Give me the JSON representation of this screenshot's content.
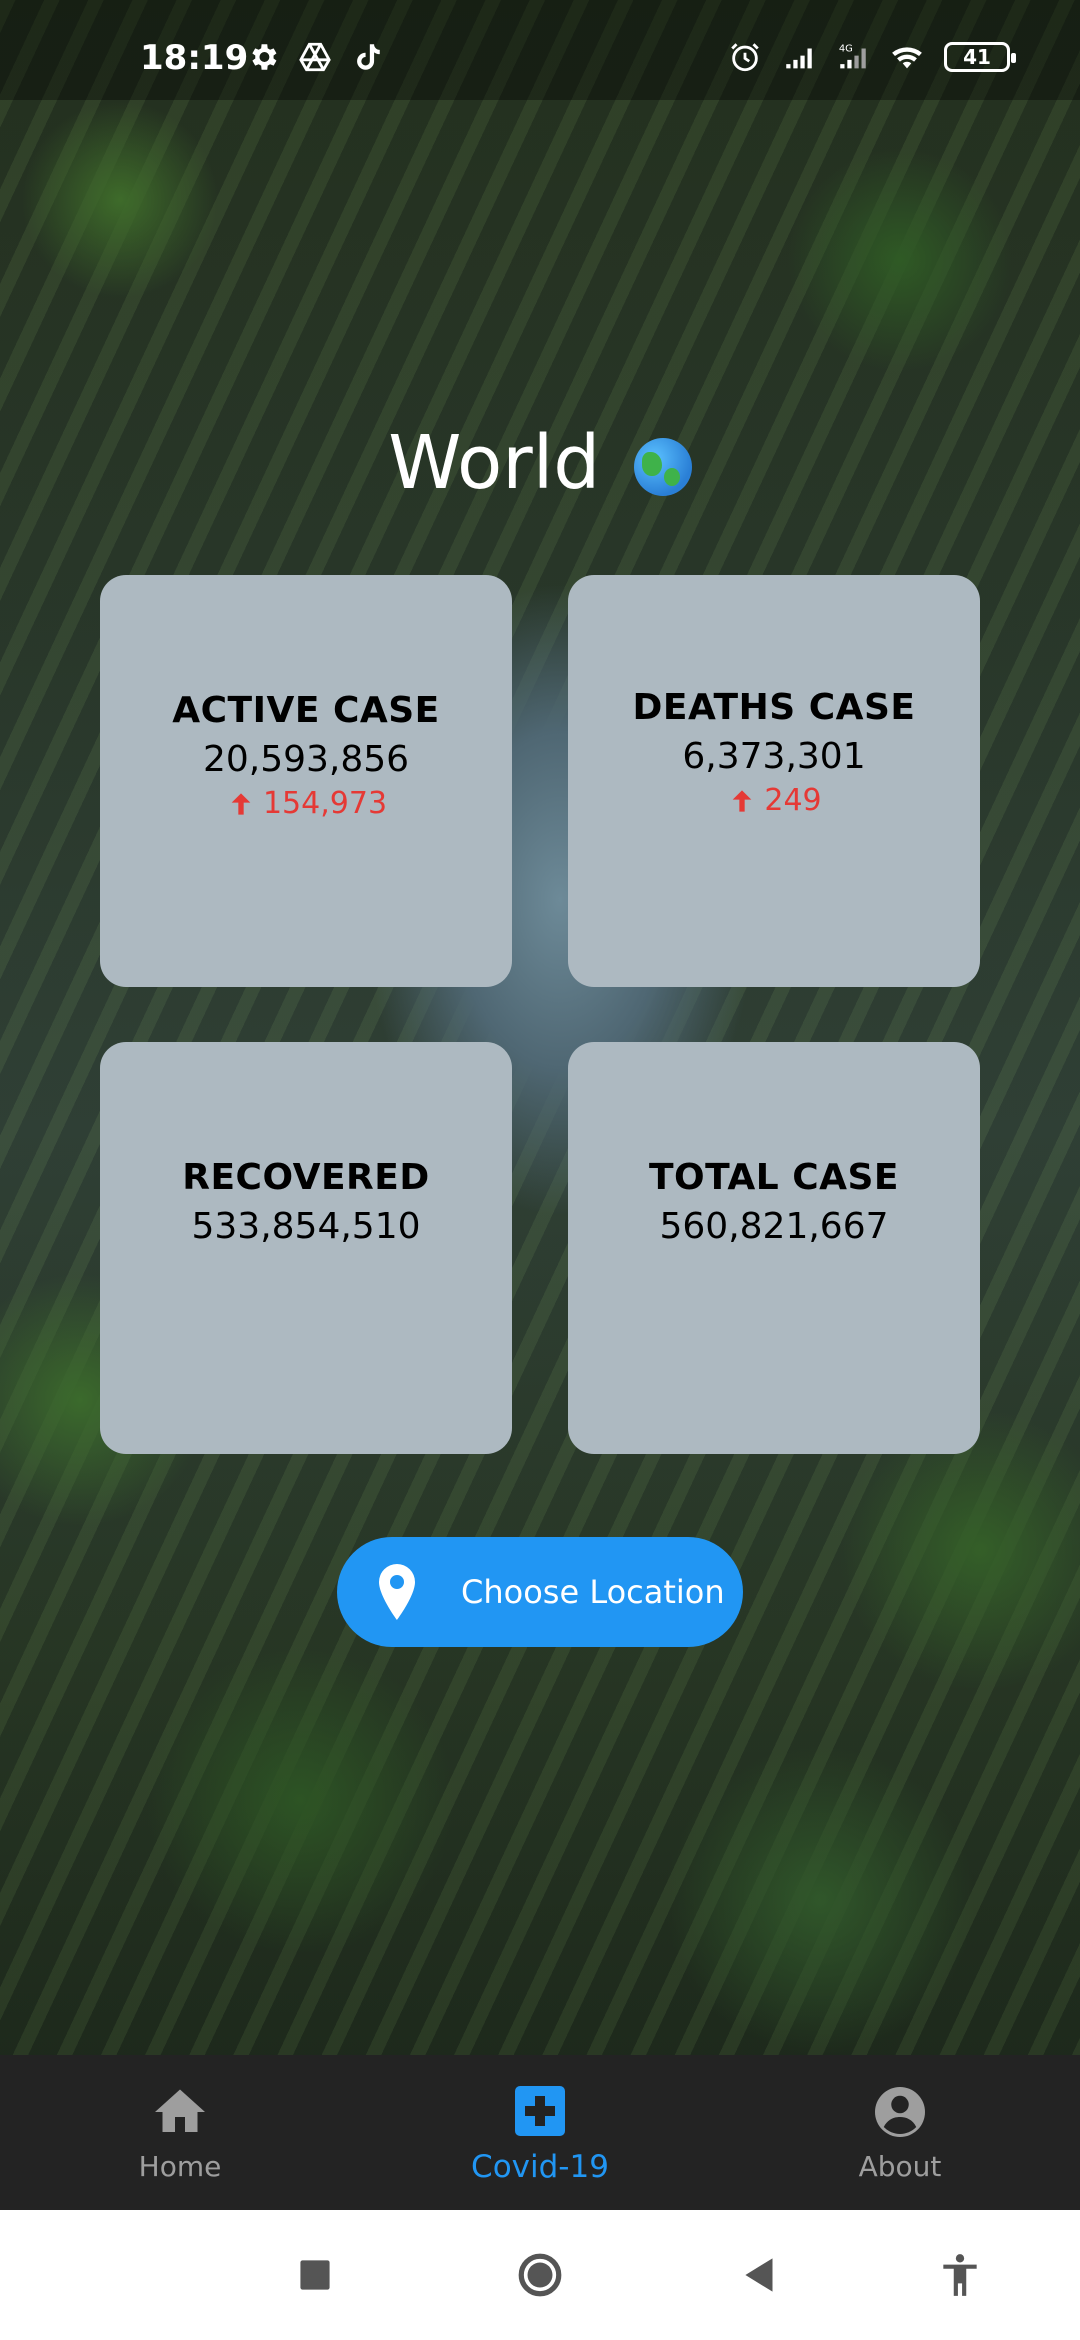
{
  "status": {
    "time": "18:19",
    "battery": "41",
    "left_icons": [
      "gear-icon",
      "drive-icon",
      "tiktok-icon"
    ],
    "right_icons": [
      "alarm-icon",
      "signal-icon",
      "4g-signal-icon",
      "wifi-icon",
      "battery-icon"
    ]
  },
  "title": "World",
  "cards": {
    "active": {
      "label": "ACTIVE CASE",
      "value": "20,593,856",
      "delta": "154,973"
    },
    "deaths": {
      "label": "DEATHS CASE",
      "value": "6,373,301",
      "delta": "249"
    },
    "recovered": {
      "label": "RECOVERED",
      "value": "533,854,510"
    },
    "total": {
      "label": "TOTAL CASE",
      "value": "560,821,667"
    }
  },
  "choose_location": {
    "label": "Choose Location"
  },
  "nav": {
    "items": [
      {
        "label": "Home",
        "icon": "home-icon"
      },
      {
        "label": "Covid-19",
        "icon": "medical-cross-icon",
        "active": true
      },
      {
        "label": "About",
        "icon": "account-circle-icon"
      }
    ]
  },
  "colors": {
    "accent": "#2196f3",
    "card_bg": "#adb9c1",
    "delta_red": "#e53935",
    "nav_bg": "#232323"
  }
}
